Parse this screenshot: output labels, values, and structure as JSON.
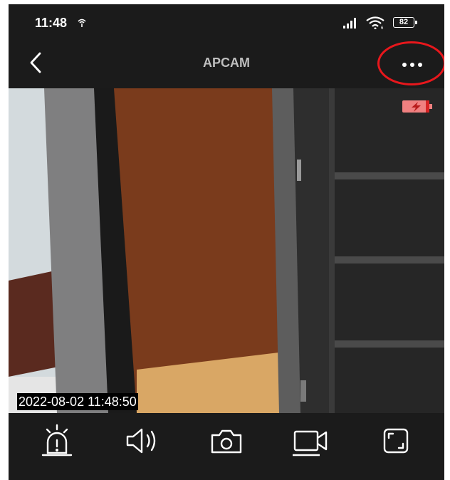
{
  "status_bar": {
    "time": "11:48",
    "battery_level": "82",
    "icons": [
      "hotspot-icon",
      "signal-icon",
      "wifi-icon",
      "battery-icon"
    ]
  },
  "header": {
    "title": "APCAM",
    "back_icon": "chevron-left-icon",
    "more_icon": "more-horizontal-icon"
  },
  "video": {
    "timestamp": "2022-08-02 11:48:50",
    "camera_battery_icon": "battery-charging-icon"
  },
  "toolbar": {
    "items": [
      {
        "id": "alarm",
        "icon": "siren-icon"
      },
      {
        "id": "sound",
        "icon": "speaker-icon"
      },
      {
        "id": "snapshot",
        "icon": "camera-icon"
      },
      {
        "id": "record",
        "icon": "video-camera-icon"
      },
      {
        "id": "fullscreen",
        "icon": "fullscreen-icon"
      }
    ]
  },
  "colors": {
    "background": "#1b1b1b",
    "title": "#bfbfbf",
    "icons": "#ffffff",
    "highlight_ring": "#e8171c",
    "camera_battery": "#f08080"
  }
}
